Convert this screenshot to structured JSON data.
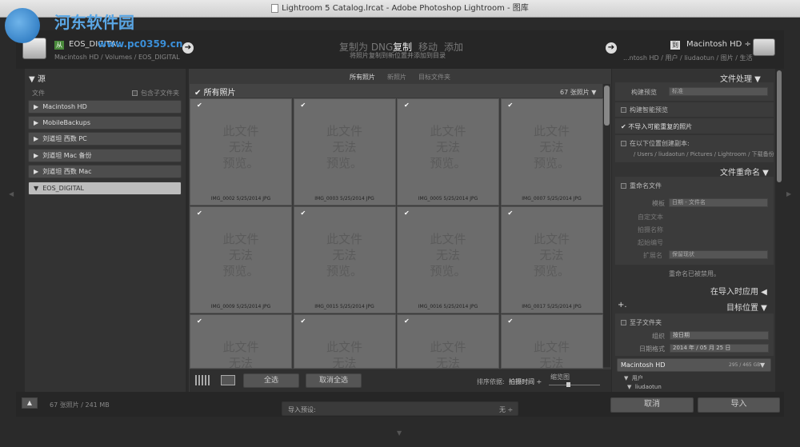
{
  "window": {
    "title": "Lightroom 5 Catalog.lrcat - Adobe Photoshop Lightroom - 图库"
  },
  "watermark": {
    "site_name": "河东软件园",
    "site_url": "www.pc0359.cn"
  },
  "source": {
    "name": "EOS_DIGITAL",
    "path": "Macintosh HD / Volumes / EOS_DIGITAL"
  },
  "modes": {
    "dng": "复制为 DNG",
    "copy": "复制",
    "move": "移动",
    "add": "添加",
    "desc": "将照片复制到新位置并添加到目录"
  },
  "destination": {
    "badge": "到",
    "name": "Macintosh HD ÷",
    "path": "...ntosh HD / 用户 / liudaotun / 图片 / 生活"
  },
  "left_panel": {
    "header": "源",
    "files_label": "文件",
    "include_sub": "包含子文件夹",
    "items": [
      "Macintosh HD",
      "MobileBackups",
      "刘道坦 西数 PC",
      "刘道坦 Mac 备份",
      "刘道坦 西数 Mac",
      "EOS_DIGITAL"
    ],
    "footer_count": "67 张照片 / 241 MB"
  },
  "center": {
    "tabs": [
      "所有照片",
      "新照片",
      "目标文件夹"
    ],
    "all_photos": "所有照片",
    "count": "67 张照片",
    "watermark_lines": [
      "此文件",
      "无法",
      "预览。"
    ],
    "thumbnails": [
      "IMG_0002 5/25/2014 JPG",
      "IMG_0003 5/25/2014 JPG",
      "IMG_0005 5/25/2014 JPG",
      "IMG_0007 5/25/2014 JPG",
      "IMG_0009 5/25/2014 JPG",
      "IMG_0015 5/25/2014 JPG",
      "IMG_0016 5/25/2014 JPG",
      "IMG_0017 5/25/2014 JPG",
      "",
      "",
      "",
      ""
    ],
    "select_all": "全选",
    "deselect_all": "取消全选",
    "sort_label": "排序依据:",
    "sort_value": "拍摄时间 ÷",
    "thumb_label": "缩览图"
  },
  "right_panel": {
    "file_handling": "文件处理",
    "build_preview_label": "构建预览",
    "build_preview_value": "标准",
    "smart_preview": "构建智能预览",
    "no_duplicates": "不导入可能重复的照片",
    "second_copy": "在以下位置创建副本:",
    "second_copy_path": "/ Users / liudaotun / Pictures / Lightroom / 下载备份",
    "file_rename": "文件重命名",
    "rename_files": "重命名文件",
    "template_label": "模板",
    "template_value": "日期 - 文件名",
    "custom_text": "自定文本",
    "shoot_name": "拍摄名称",
    "start_number": "起始编号",
    "extension_label": "扩展名",
    "extension_value": "保留现状",
    "rename_note": "重命名已被禁用。",
    "apply_during_import": "在导入时应用",
    "destination": "目标位置",
    "plus": "+.",
    "into_subfolder": "至子文件夹",
    "organize_label": "组织",
    "organize_value": "按日期",
    "date_format_label": "日期格式",
    "date_format_value": "2014 年 / 05 月 25 日",
    "volume": "Macintosh HD",
    "volume_size": "295 / 465 GB",
    "tree_users": "用户",
    "tree_user": "liudaotun"
  },
  "bottom": {
    "preset_label": "导入预设:",
    "preset_value": "无 ÷",
    "cancel": "取消",
    "import": "导入"
  }
}
